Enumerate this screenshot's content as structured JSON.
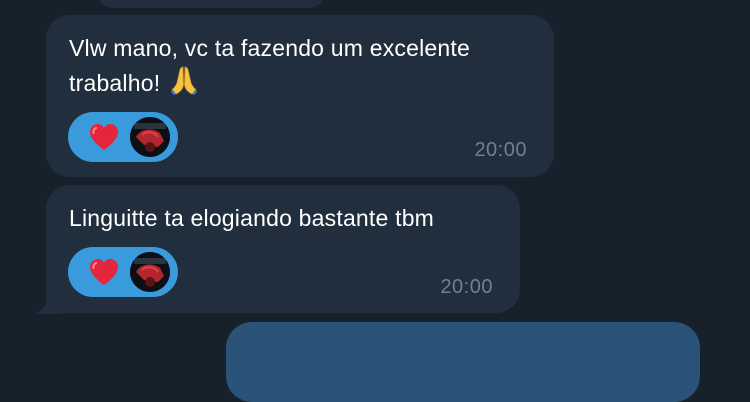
{
  "messages": [
    {
      "text_line1": "Vlw mano, vc ta fazendo um excelente",
      "text_line2": "trabalho! ",
      "emoji": "pray-icon",
      "reaction": "heart-icon",
      "time": "20:00"
    },
    {
      "text_line1": "Linguitte ta elogiando bastante tbm",
      "reaction": "heart-icon",
      "time": "20:00"
    }
  ],
  "colors": {
    "background": "#17212b",
    "incoming_bubble": "#212e3d",
    "outgoing_bubble": "#2b5278",
    "reaction_pill": "#3a9bdc",
    "heart": "#e3263b",
    "timestamp": "#6d8196"
  }
}
